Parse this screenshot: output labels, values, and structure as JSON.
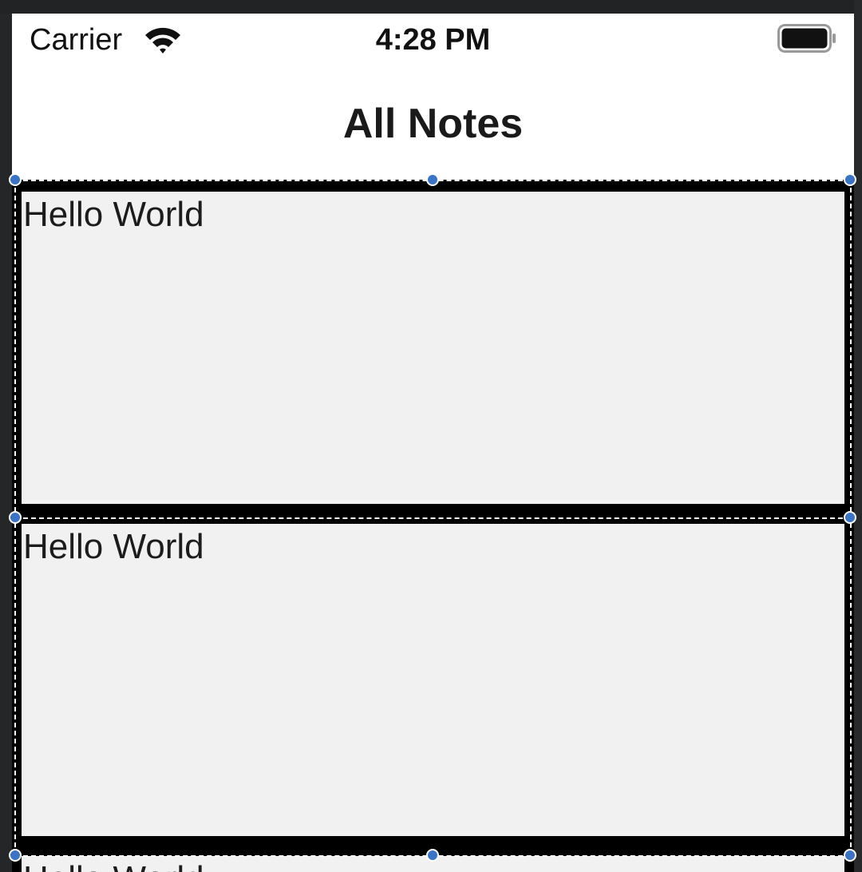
{
  "status_bar": {
    "carrier": "Carrier",
    "time": "4:28 PM",
    "wifi_icon": "wifi-icon",
    "battery_icon": "battery-icon"
  },
  "nav": {
    "title": "All Notes"
  },
  "notes": [
    {
      "title": "Hello World"
    },
    {
      "title": "Hello World"
    },
    {
      "title": "Hello World"
    }
  ],
  "colors": {
    "cell_background": "#f1f1f1",
    "separator": "#000000",
    "selection_handle": "#3a74c6",
    "canvas_background": "#252628"
  }
}
